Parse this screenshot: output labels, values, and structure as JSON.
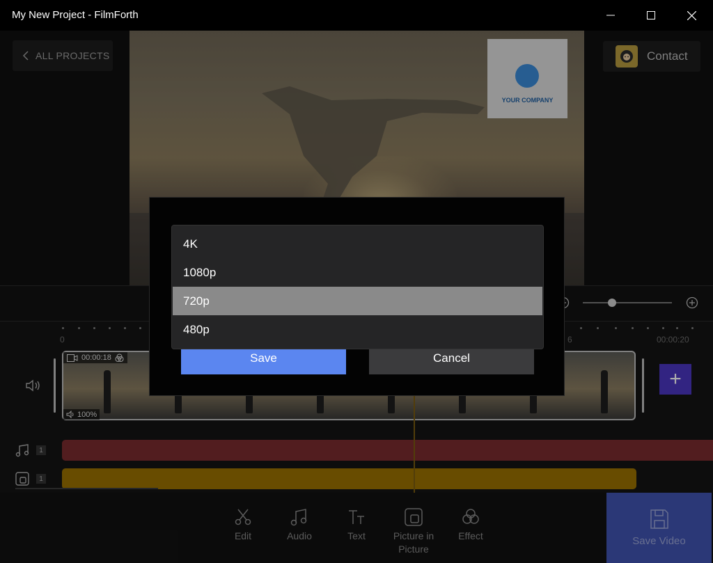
{
  "window": {
    "title": "My New Project - FilmForth",
    "minimize_icon": "minimize-icon",
    "maximize_icon": "maximize-icon",
    "close_icon": "close-icon"
  },
  "header": {
    "back_label": "ALL PROJECTS",
    "contact_label": "Contact"
  },
  "preview": {
    "watermark_text": "YOUR COMPANY"
  },
  "timeline": {
    "ruler_start": "0",
    "ruler_partial": "6",
    "ruler_end": "00:00:20",
    "clip_duration": "00:00:18",
    "clip_volume": "100%",
    "audio_track_count": "1",
    "pip_track_count": "1",
    "add_clip_label": "+"
  },
  "toolbar": {
    "items": [
      {
        "label": "Edit",
        "icon": "scissors-icon"
      },
      {
        "label": "Audio",
        "icon": "music-note-icon"
      },
      {
        "label": "Text",
        "icon": "text-icon"
      },
      {
        "label": "Picture in Picture",
        "icon": "pip-icon"
      },
      {
        "label": "Effect",
        "icon": "effect-icon"
      }
    ],
    "save_video_label": "Save Video"
  },
  "dialog": {
    "resolutions": [
      "4K",
      "1080p",
      "720p",
      "480p"
    ],
    "selected": "720p",
    "save_label": "Save",
    "cancel_label": "Cancel"
  },
  "colors": {
    "accent_blue": "#5b86f0",
    "save_video_bg": "#4053b0",
    "audio_track": "#7a2b2e",
    "pip_track": "#9a7100",
    "add_clip": "#4a35c0"
  }
}
